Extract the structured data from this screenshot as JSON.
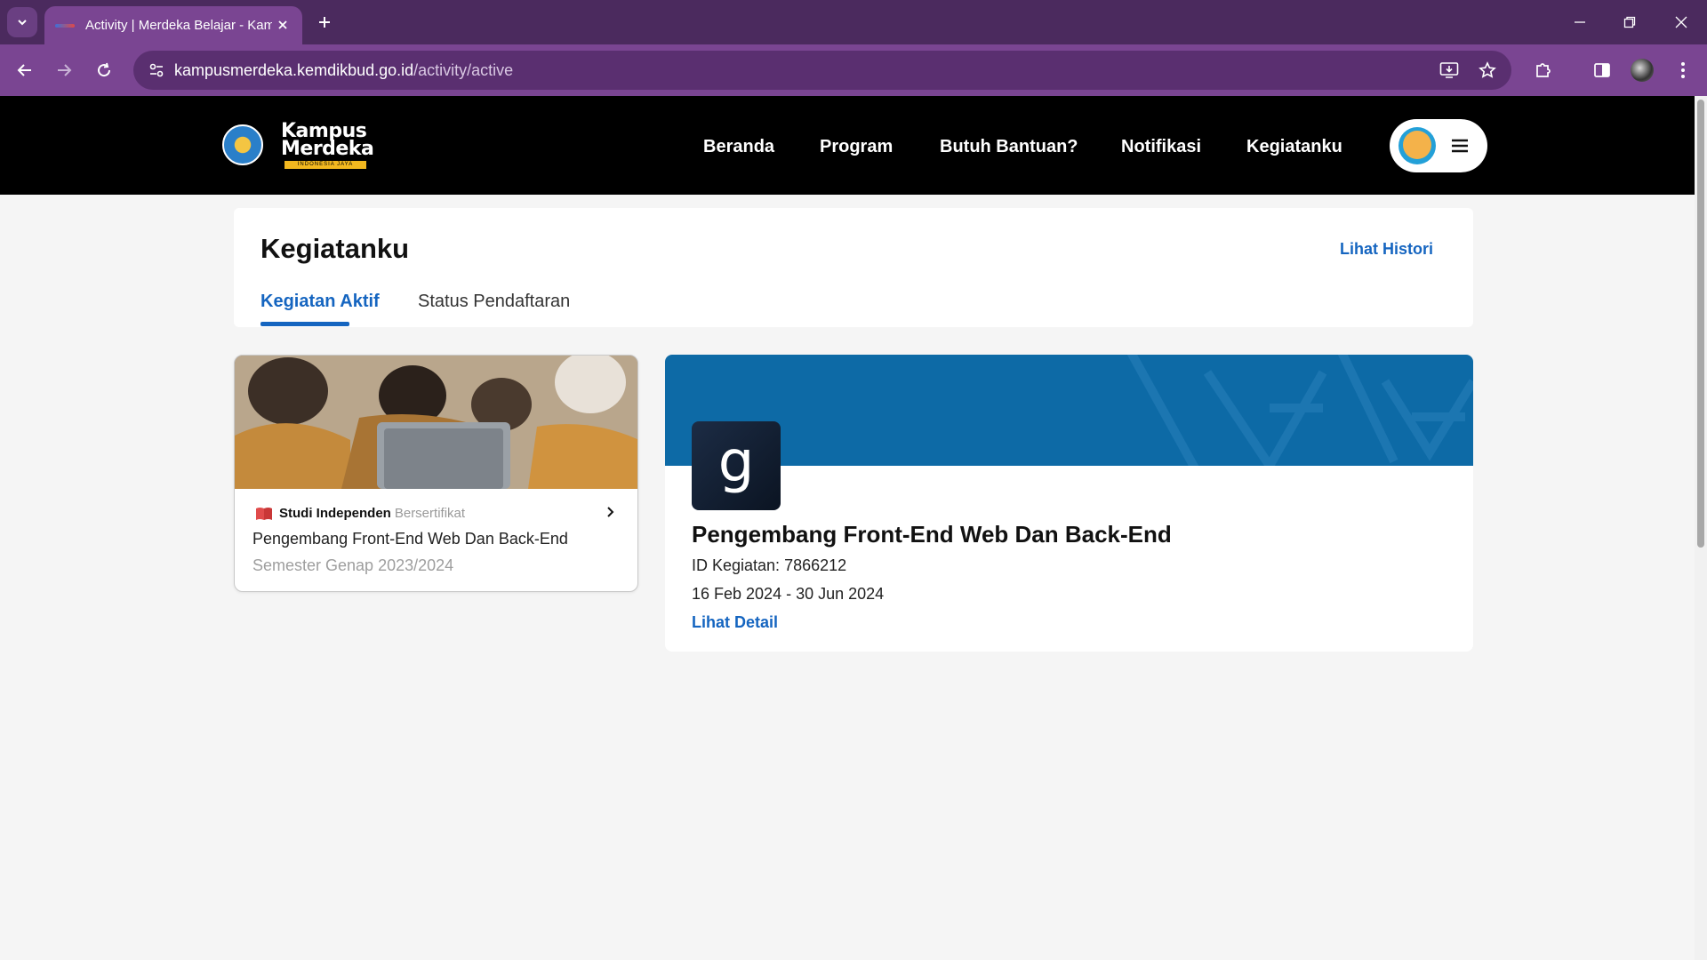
{
  "browser": {
    "tab_title": "Activity | Merdeka Belajar - Kam",
    "url_host": "kampusmerdeka.kemdikbud.go.id",
    "url_path": "/activity/active",
    "theme_color": "#7a4592"
  },
  "site": {
    "logo_line1": "Kampus",
    "logo_line2": "Merdeka",
    "logo_tagline": "INDONESIA JAYA",
    "nav": [
      "Beranda",
      "Program",
      "Butuh Bantuan?",
      "Notifikasi",
      "Kegiatanku"
    ]
  },
  "page": {
    "title": "Kegiatanku",
    "history_link": "Lihat Histori",
    "tabs": [
      "Kegiatan Aktif",
      "Status Pendaftaran"
    ],
    "active_tab": "Kegiatan Aktif",
    "accent_color": "#1565c0"
  },
  "activity_card": {
    "program_type": "Studi Independen",
    "badge": "Bersertifikat",
    "name": "Pengembang Front-End Web Dan Back-End",
    "semester": "Semester Genap 2023/2024",
    "icon": "book-icon"
  },
  "detail": {
    "title": "Pengembang Front-End Web Dan Back-End",
    "activity_id": "ID Kegiatan: 7866212",
    "dates": "16 Feb 2024 - 30 Jun 2024",
    "detail_link": "Lihat Detail",
    "logo_glyph": "g",
    "banner_color": "#0d6aa6"
  }
}
